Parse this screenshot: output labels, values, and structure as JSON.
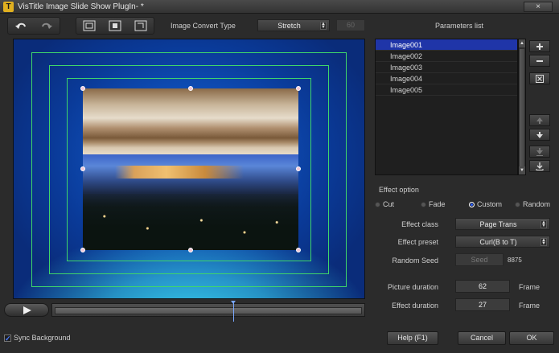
{
  "window": {
    "app_icon_letter": "T",
    "title": "VisTitle Image Slide Show PlugIn- *",
    "close_glyph": "×"
  },
  "toolbar": {
    "image_convert_type_label": "Image Convert Type",
    "convert_mode": "Stretch",
    "disabled_value": "60"
  },
  "parameters": {
    "title": "Parameters list",
    "items": [
      "Image001",
      "Image002",
      "Image003",
      "Image004",
      "Image005"
    ],
    "selected_index": 0
  },
  "effect": {
    "title": "Effect option",
    "modes": [
      "Cut",
      "Fade",
      "Custom",
      "Random"
    ],
    "selected_mode": "Custom",
    "effect_class_label": "Effect class",
    "effect_class": "Page Trans",
    "effect_preset_label": "Effect preset",
    "effect_preset": "Curl(B to T)",
    "random_seed_label": "Random Seed",
    "seed_button": "Seed",
    "seed_value": "8875",
    "picture_duration_label": "Picture duration",
    "picture_duration": "62",
    "effect_duration_label": "Effect duration",
    "effect_duration": "27",
    "frame_unit": "Frame"
  },
  "footer": {
    "sync_background_label": "Sync Background",
    "sync_background_checked": true,
    "help_button": "Help (F1)",
    "cancel_button": "Cancel",
    "ok_button": "OK"
  },
  "timeline": {
    "position_fraction": 0.58
  },
  "colors": {
    "selection": "#1f35a8",
    "guide": "#3fd66a",
    "accent": "#2a5fff"
  }
}
